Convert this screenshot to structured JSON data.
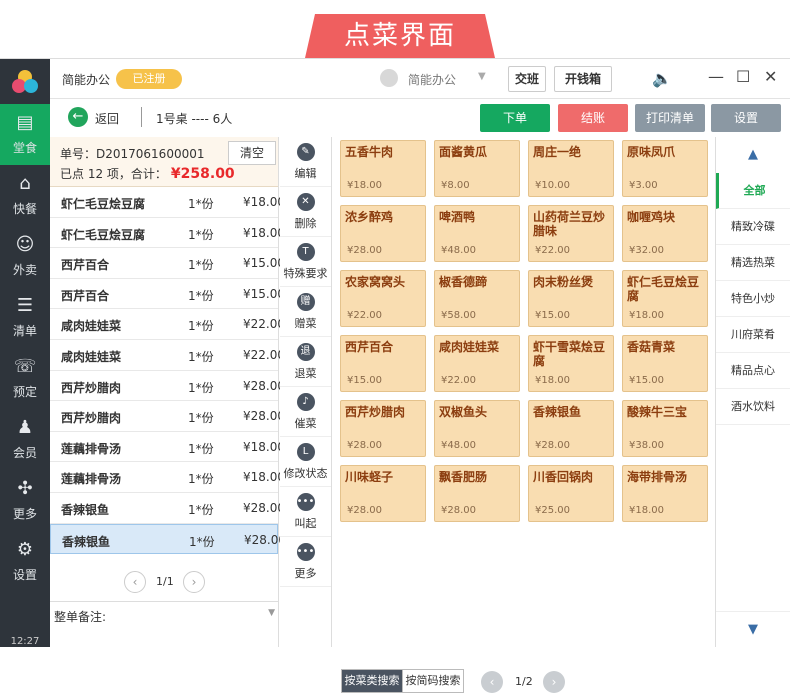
{
  "banner": {
    "title": "点菜界面"
  },
  "sidebar": {
    "items": [
      {
        "label": "堂食",
        "icon": "▤"
      },
      {
        "label": "快餐",
        "icon": "⌂"
      },
      {
        "label": "外卖",
        "icon": "☺"
      },
      {
        "label": "清单",
        "icon": "☰"
      },
      {
        "label": "预定",
        "icon": "☏"
      },
      {
        "label": "会员",
        "icon": "♟"
      },
      {
        "label": "更多",
        "icon": "✣"
      },
      {
        "label": "设置",
        "icon": "⚙"
      }
    ],
    "clock": "12:27"
  },
  "topbar": {
    "title": "简能办公",
    "status_badge": "已注册",
    "user": "简能办公",
    "shift_button": "交班",
    "cash_button": "开钱箱"
  },
  "toolbar": {
    "back_label": "返回",
    "table_info": "1号桌 ---- 6人",
    "order_button": "下单",
    "checkout_button": "结账",
    "print_button": "打印清单",
    "settings_button": "设置"
  },
  "order": {
    "number": "单号：D2017061600001",
    "summary_prefix": "已点 12 项，合计：",
    "total": "¥258.00",
    "clear_button": "清空",
    "items": [
      {
        "name": "虾仁毛豆烩豆腐",
        "qty": "1*份",
        "price": "¥18.00"
      },
      {
        "name": "虾仁毛豆烩豆腐",
        "qty": "1*份",
        "price": "¥18.00"
      },
      {
        "name": "西芹百合",
        "qty": "1*份",
        "price": "¥15.00"
      },
      {
        "name": "西芹百合",
        "qty": "1*份",
        "price": "¥15.00"
      },
      {
        "name": "咸肉娃娃菜",
        "qty": "1*份",
        "price": "¥22.00"
      },
      {
        "name": "咸肉娃娃菜",
        "qty": "1*份",
        "price": "¥22.00"
      },
      {
        "name": "西芹炒腊肉",
        "qty": "1*份",
        "price": "¥28.00"
      },
      {
        "name": "西芹炒腊肉",
        "qty": "1*份",
        "price": "¥28.00"
      },
      {
        "name": "莲藕排骨汤",
        "qty": "1*份",
        "price": "¥18.00"
      },
      {
        "name": "莲藕排骨汤",
        "qty": "1*份",
        "price": "¥18.00"
      },
      {
        "name": "香辣银鱼",
        "qty": "1*份",
        "price": "¥28.00"
      },
      {
        "name": "香辣银鱼",
        "qty": "1*份",
        "price": "¥28.00"
      }
    ],
    "page": "1/1",
    "remark_label": "整单备注:"
  },
  "operations": [
    {
      "label": "编辑",
      "icon": "✎"
    },
    {
      "label": "删除",
      "icon": "✕"
    },
    {
      "label": "特殊要求",
      "icon": "T"
    },
    {
      "label": "赠菜",
      "icon": "赠"
    },
    {
      "label": "退菜",
      "icon": "退"
    },
    {
      "label": "催菜",
      "icon": "♪"
    },
    {
      "label": "修改状态",
      "icon": "L"
    },
    {
      "label": "叫起",
      "icon": "•••"
    },
    {
      "label": "更多",
      "icon": "•••"
    }
  ],
  "dishes": [
    {
      "name": "五香牛肉",
      "price": "¥18.00"
    },
    {
      "name": "面酱黄瓜",
      "price": "¥8.00"
    },
    {
      "name": "周庄一绝",
      "price": "¥10.00"
    },
    {
      "name": "原味凤爪",
      "price": "¥3.00"
    },
    {
      "name": "浓乡醉鸡",
      "price": "¥28.00"
    },
    {
      "name": "啤酒鸭",
      "price": "¥48.00"
    },
    {
      "name": "山药荷兰豆炒腊味",
      "price": "¥22.00"
    },
    {
      "name": "咖喱鸡块",
      "price": "¥32.00"
    },
    {
      "name": "农家窝窝头",
      "price": "¥22.00"
    },
    {
      "name": "椒香德蹄",
      "price": "¥58.00"
    },
    {
      "name": "肉末粉丝煲",
      "price": "¥15.00"
    },
    {
      "name": "虾仁毛豆烩豆腐",
      "price": "¥18.00"
    },
    {
      "name": "西芹百合",
      "price": "¥15.00"
    },
    {
      "name": "咸肉娃娃菜",
      "price": "¥22.00"
    },
    {
      "name": "虾干雪菜烩豆腐",
      "price": "¥18.00"
    },
    {
      "name": "香菇青菜",
      "price": "¥15.00"
    },
    {
      "name": "西芹炒腊肉",
      "price": "¥28.00"
    },
    {
      "name": "双椒鱼头",
      "price": "¥48.00"
    },
    {
      "name": "香辣银鱼",
      "price": "¥28.00"
    },
    {
      "name": "酸辣牛三宝",
      "price": "¥38.00"
    },
    {
      "name": "川味蛏子",
      "price": "¥28.00"
    },
    {
      "name": "飘香肥肠",
      "price": "¥28.00"
    },
    {
      "name": "川香回锅肉",
      "price": "¥25.00"
    },
    {
      "name": "海带排骨汤",
      "price": "¥18.00"
    }
  ],
  "menu_footer": {
    "search_by_category": "按菜类搜索",
    "search_by_code": "按简码搜索",
    "page": "1/2"
  },
  "categories": [
    "全部",
    "精致冷碟",
    "精选热菜",
    "特色小炒",
    "川府菜肴",
    "精品点心",
    "酒水饮料"
  ],
  "colors": {
    "accent_green": "#1fa954",
    "checkout_red": "#ef6b6b",
    "total_red": "#e8292b",
    "dish_bg": "#f9ddb1"
  }
}
